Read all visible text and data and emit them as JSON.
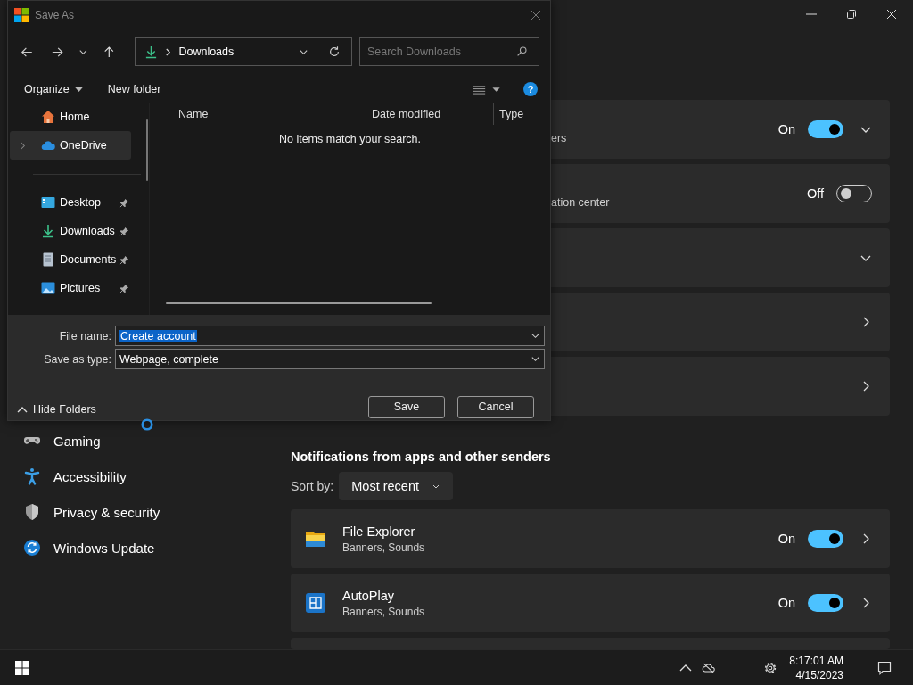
{
  "settings": {
    "cards": [
      {
        "kind": "toggle_expand",
        "subtitle": "ers",
        "state_label": "On",
        "on": true
      },
      {
        "kind": "toggle",
        "subtitle": "ation center",
        "state_label": "Off",
        "on": false
      },
      {
        "kind": "expand"
      },
      {
        "kind": "link"
      },
      {
        "kind": "link"
      }
    ],
    "sidebar": [
      {
        "label": "Gaming",
        "kind": "gamepad"
      },
      {
        "label": "Accessibility",
        "kind": "person"
      },
      {
        "label": "Privacy & security",
        "kind": "shield"
      },
      {
        "label": "Windows Update",
        "kind": "update"
      }
    ],
    "section_heading": "Notifications from apps and other senders",
    "sort_label": "Sort by:",
    "sort_value": "Most recent",
    "apps": [
      {
        "name": "File Explorer",
        "detail": "Banners, Sounds",
        "state_label": "On",
        "on": true,
        "kind": "folder"
      },
      {
        "name": "AutoPlay",
        "detail": "Banners, Sounds",
        "state_label": "On",
        "on": true,
        "kind": "autoplay"
      }
    ]
  },
  "save_dialog": {
    "title": "Save As",
    "location": "Downloads",
    "search": {
      "placeholder": "Search Downloads"
    },
    "toolbar": [
      "Organize",
      "New folder"
    ],
    "help": "?",
    "nav_items": [
      {
        "label": "Home",
        "kind": "home",
        "selected": false,
        "pinned": false,
        "expandable": false
      },
      {
        "label": "OneDrive",
        "kind": "cloud",
        "selected": true,
        "pinned": false,
        "expandable": true
      },
      {
        "label": "Desktop",
        "kind": "desktop",
        "selected": false,
        "pinned": true,
        "expandable": false
      },
      {
        "label": "Downloads",
        "kind": "download",
        "selected": false,
        "pinned": true,
        "expandable": false
      },
      {
        "label": "Documents",
        "kind": "document",
        "selected": false,
        "pinned": true,
        "expandable": false
      },
      {
        "label": "Pictures",
        "kind": "pictures",
        "selected": false,
        "pinned": true,
        "expandable": false
      }
    ],
    "columns": [
      "Name",
      "Date modified",
      "Type"
    ],
    "empty_message": "No items match your search.",
    "file_name_label": "File name:",
    "file_name": "Create account",
    "type_label": "Save as type:",
    "save_type": "Webpage, complete",
    "buttons": [
      "Save",
      "Cancel"
    ],
    "hide_folders": "Hide Folders"
  },
  "taskbar": {
    "time": "8:17:01 AM",
    "date": "4/15/2023"
  }
}
